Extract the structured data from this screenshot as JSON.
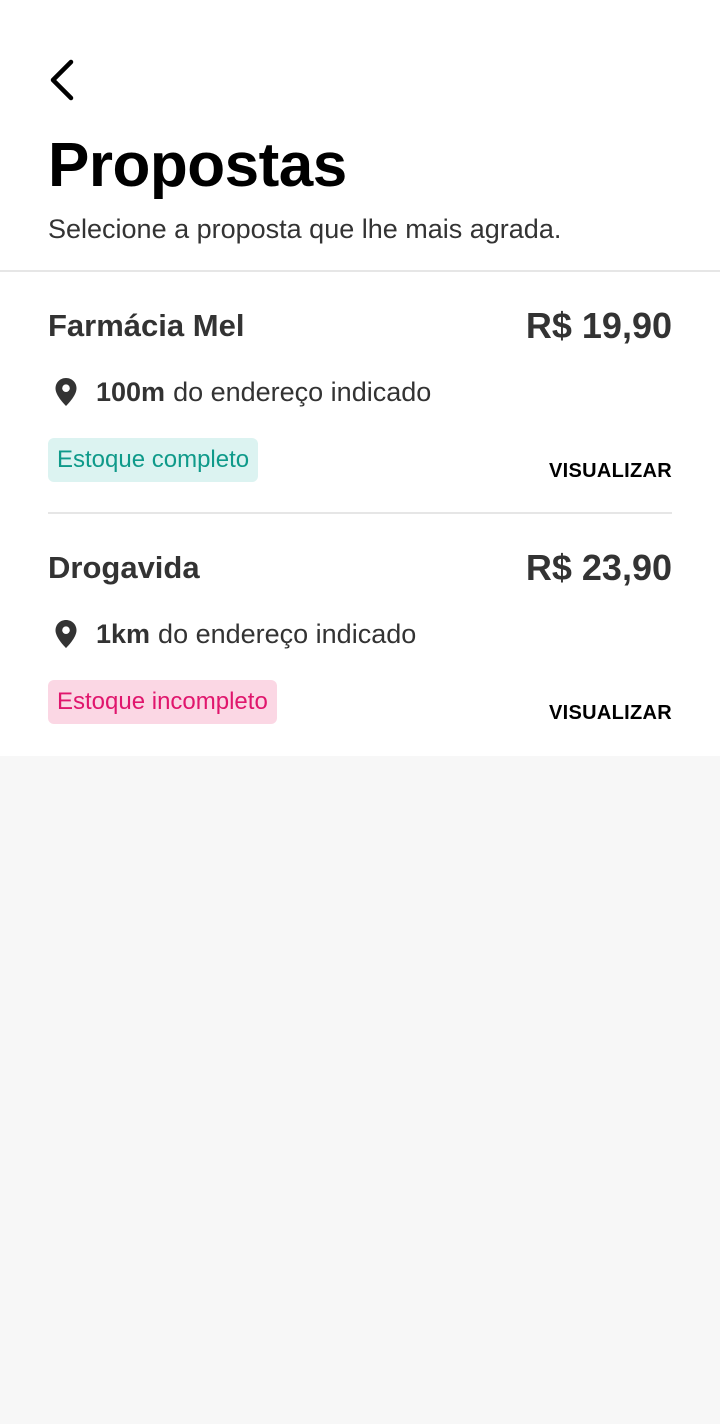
{
  "header": {
    "back_icon": "chevron-left-icon",
    "title": "Propostas",
    "subtitle": "Selecione a proposta que lhe mais agrada."
  },
  "proposals": [
    {
      "store_name": "Farmácia Mel",
      "price": "R$ 19,90",
      "distance_value": "100m",
      "distance_text": "do endereço indicado",
      "stock_label": "Estoque completo",
      "stock_status": "complete",
      "view_label": "VISUALIZAR"
    },
    {
      "store_name": "Drogavida",
      "price": "R$ 23,90",
      "distance_value": "1km",
      "distance_text": "do endereço indicado",
      "stock_label": "Estoque incompleto",
      "stock_status": "incomplete",
      "view_label": "VISUALIZAR"
    }
  ],
  "icons": {
    "location": "location-pin-icon"
  },
  "colors": {
    "background": "#f7f7f7",
    "surface": "#ffffff",
    "text_primary": "#333333",
    "stock_complete_bg": "#dcf3f1",
    "stock_complete_text": "#0f9a8a",
    "stock_incomplete_bg": "#fbd7e4",
    "stock_incomplete_text": "#e0166d"
  }
}
